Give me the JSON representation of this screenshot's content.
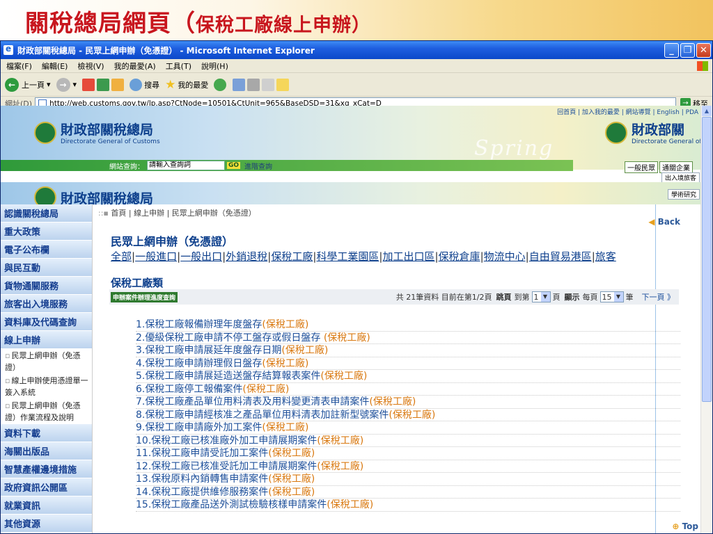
{
  "slide": {
    "title": "關稅總局網頁（",
    "title_sub": "保稅工廠線上申辦）"
  },
  "browser": {
    "window_title": "財政部關稅總局 - 民眾上網申辦（免憑證） - Microsoft Internet Explorer",
    "menu": [
      "檔案(F)",
      "編輯(E)",
      "檢視(V)",
      "我的最愛(A)",
      "工具(T)",
      "說明(H)"
    ],
    "toolbar": {
      "back": "上一頁",
      "search": "搜尋",
      "favorites": "我的最愛"
    },
    "address_label": "網址(D)",
    "address_url": "http://web.customs.gov.tw/lp.asp?CtNode=10501&CtUnit=965&BaseDSD=31&xq_xCat=D",
    "go_label": "移至"
  },
  "site": {
    "top_links": "回首頁 | 加入我的最愛 | 網站導覽 | English | PDA",
    "logo_cn": "財政部關稅總局",
    "logo_en": "Directorate General of Customs",
    "logo_cn_partial": "財政部關",
    "banner_word": "Spring",
    "search_label": "網站查詢：",
    "search_placeholder": "請輸入查詢詞",
    "search_go": "GO",
    "search_advanced": "進階查詢",
    "user_types": [
      "一般民眾",
      "通關企業"
    ],
    "side_tabs": [
      "出入境旅客",
      "學術研究"
    ]
  },
  "nav": {
    "items_top": [
      "認識關稅總局",
      "重大政策",
      "電子公布欄",
      "與民互動",
      "貨物通關服務",
      "旅客出入境服務",
      "資料庫及代碼查詢",
      "線上申辦"
    ],
    "sub_items": [
      "民眾上網申辦（免憑證）",
      "線上申辦使用憑證單一簽入系統",
      "民眾上網申辦（免憑證）作業流程及說明"
    ],
    "items_bottom": [
      "資料下載",
      "海關出版品",
      "智慧產權邊境措施",
      "政府資訊公開區",
      "就業資訊",
      "其他資源"
    ]
  },
  "content": {
    "breadcrumb": "首頁 | 線上申辦 | 民眾上網申辦（免憑證）",
    "back": "Back",
    "heading": "民眾上網申辦（免憑證）",
    "categories": [
      "全部",
      "一般進口",
      "一般出口",
      "外銷退稅",
      "保稅工廠",
      "科學工業園區",
      "加工出口區",
      "保稅倉庫",
      "物流中心",
      "自由貿易港區",
      "旅客"
    ],
    "current_category": "保稅工廠類",
    "progress_button": "申辦案件辦理進度查詢",
    "pager": {
      "summary": "共 21筆資料  目前在第1/2頁",
      "jump_label": "跳頁",
      "to_label": "到第",
      "page_value": "1",
      "page_unit": "頁",
      "show_label": "顯示",
      "per_label": "每頁",
      "per_value": "15",
      "per_unit": "筆",
      "next": "下一頁 》"
    },
    "items": [
      {
        "no": "1.",
        "title": "保稅工廠報備辦理年度盤存",
        "tag": "(保稅工廠)"
      },
      {
        "no": "2.",
        "title": "優級保稅工廠申請不停工盤存或假日盤存 ",
        "tag": "(保稅工廠)"
      },
      {
        "no": "3.",
        "title": "保稅工廠申請展延年度盤存日期",
        "tag": "(保稅工廠)"
      },
      {
        "no": "4.",
        "title": "保稅工廠申請辦理假日盤存",
        "tag": "(保稅工廠)"
      },
      {
        "no": "5.",
        "title": "保稅工廠申請展延造送盤存結算報表案件",
        "tag": "(保稅工廠)"
      },
      {
        "no": "6.",
        "title": "保稅工廠停工報備案件",
        "tag": "(保稅工廠)"
      },
      {
        "no": "7.",
        "title": "保稅工廠產品單位用料清表及用料變更清表申請案件",
        "tag": "(保稅工廠)"
      },
      {
        "no": "8.",
        "title": "保稅工廠申請經核准之產品單位用料清表加註新型號案件",
        "tag": "(保稅工廠)"
      },
      {
        "no": "9.",
        "title": "保稅工廠申請廠外加工案件",
        "tag": "(保稅工廠)"
      },
      {
        "no": "10.",
        "title": "保稅工廠已核准廠外加工申請展期案件",
        "tag": "(保稅工廠)"
      },
      {
        "no": "11.",
        "title": "保稅工廠申請受託加工案件",
        "tag": "(保稅工廠)"
      },
      {
        "no": "12.",
        "title": "保稅工廠已核准受託加工申請展期案件",
        "tag": "(保稅工廠)"
      },
      {
        "no": "13.",
        "title": "保稅原料內銷轉售申請案件",
        "tag": "(保稅工廠)"
      },
      {
        "no": "14.",
        "title": "保稅工廠提供維修服務案件",
        "tag": "(保稅工廠)"
      },
      {
        "no": "15.",
        "title": "保稅工廠產品送外測試檢驗核樣申請案件",
        "tag": "(保稅工廠)"
      }
    ],
    "top_link": "Top"
  }
}
